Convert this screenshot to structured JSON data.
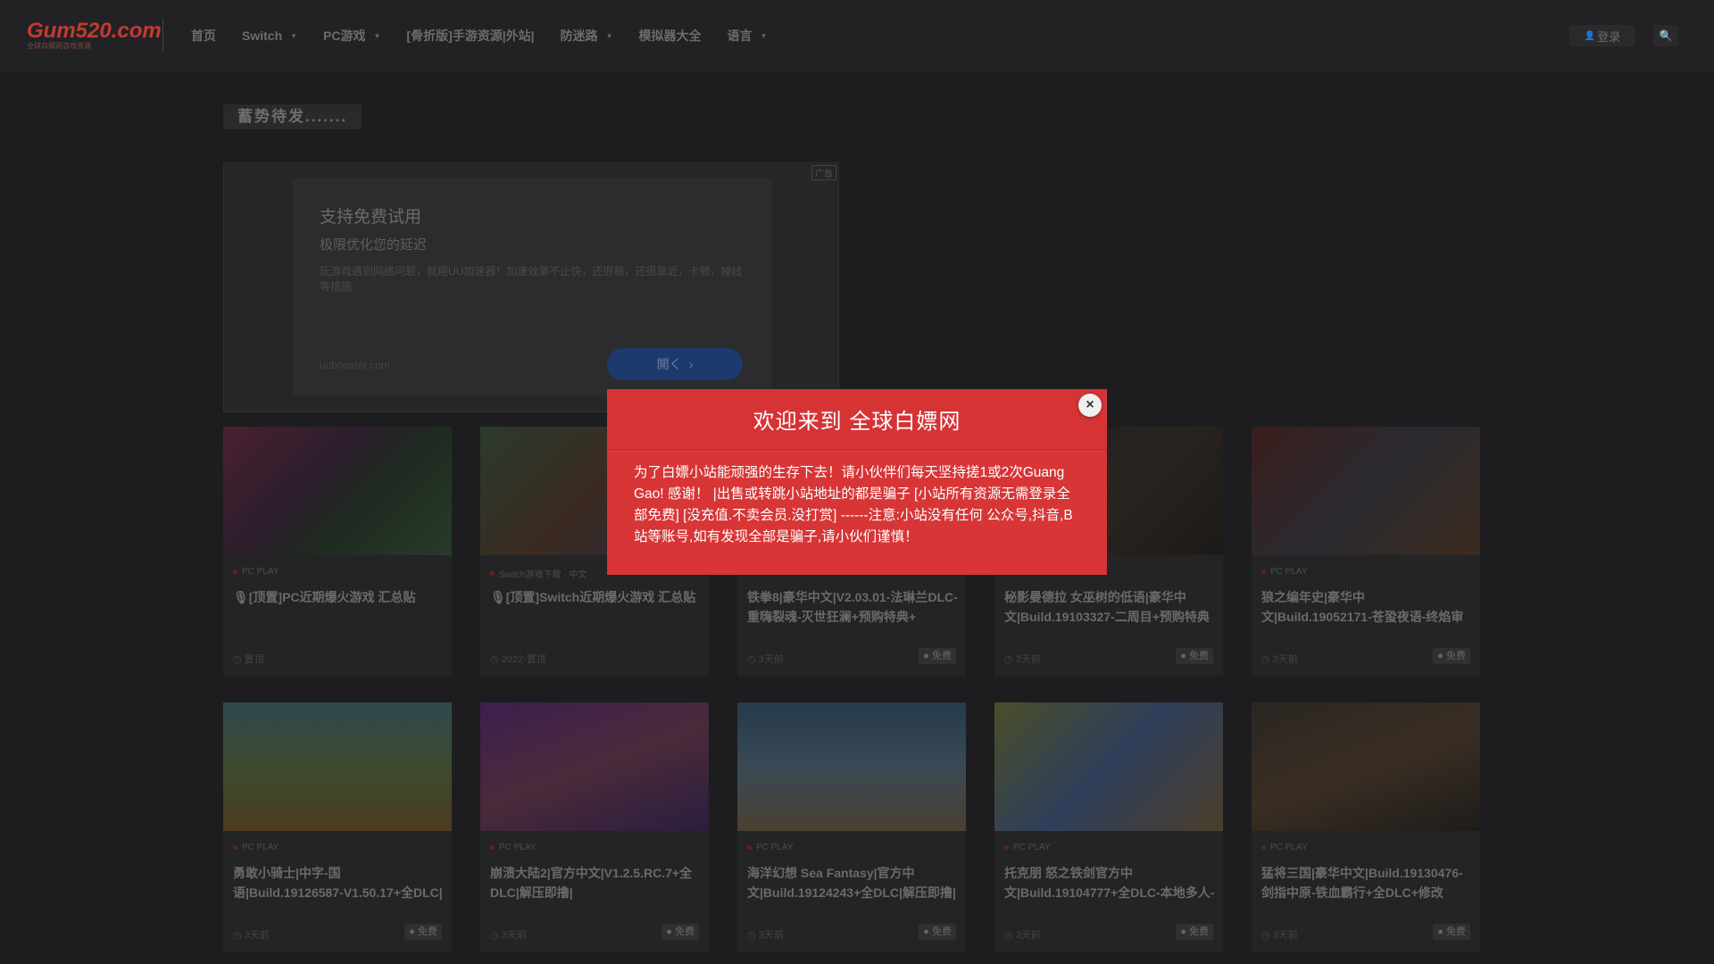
{
  "header": {
    "logo_main": "Gum520.com",
    "logo_sub": "全球白嫖网游戏资源",
    "nav": [
      {
        "label": "首页",
        "dropdown": false
      },
      {
        "label": "Switch",
        "dropdown": true
      },
      {
        "label": "PC游戏",
        "dropdown": true
      },
      {
        "label": "[骨折版]手游资源|外站|",
        "dropdown": false
      },
      {
        "label": "防迷路",
        "dropdown": true
      },
      {
        "label": "模拟器大全",
        "dropdown": false
      },
      {
        "label": "语言",
        "dropdown": true
      }
    ],
    "login_label": "登录",
    "search_icon": "search-icon"
  },
  "section_title": "蓄势待发.......",
  "ad": {
    "tag": "广告",
    "title": "支持免费试用",
    "subtitle": "极限优化您的延迟",
    "description": "玩游戏遇到网络问题，就用UU加速器！加速效果不止快，还很稳，还很靠近，卡顿，掉线等措施",
    "url": "uubooster.com",
    "open_label": "開く"
  },
  "cards_row1": [
    {
      "category": "PC PLAY",
      "title": "🎙[顶置]PC近期爆火游戏 汇总贴",
      "foot": "置顶",
      "free": ""
    },
    {
      "category": "Switch游戏下载 · 中文",
      "title": "🎙[顶置]Switch近期爆火游戏 汇总贴",
      "foot": "2022-置顶",
      "free": ""
    },
    {
      "category": "PC PLAY",
      "title": "铁拳8|豪华中文|V2.03.01-法琳兰DLC-重嗨裂魂-灭世狂澜+预购特典+",
      "foot": "3天前",
      "free": "免费"
    },
    {
      "category": "PC PLAY",
      "title": "秘影曼德拉 女巫树的低语|豪华中文|Build.19103327-二周目+预购特典",
      "foot": "3天前",
      "free": "免费"
    },
    {
      "category": "PC PLAY",
      "title": "狼之编年史|豪华中文|Build.19052171-苍蛩夜语-终焰审判+全DLC|解",
      "foot": "3天前",
      "free": "免费"
    }
  ],
  "cards_row2": [
    {
      "category": "PC PLAY",
      "title": "勇敢小骑士|中字-国语|Build.19126587-V1.50.17+全DLC|解压即撸|",
      "foot": "3天前",
      "free": "免费"
    },
    {
      "category": "PC PLAY",
      "title": "崩溃大陆2|官方中文|V1.2.5.RC.7+全DLC|解压即撸|",
      "foot": "3天前",
      "free": "免费"
    },
    {
      "category": "PC PLAY",
      "title": "海洋幻想 Sea Fantasy|官方中文|Build.19124243+全DLC|解压即撸|",
      "foot": "3天前",
      "free": "免费"
    },
    {
      "category": "PC PLAY",
      "title": "托克朋 怒之铁剑官方中文|Build.19104777+全DLC-本地多人-支持手",
      "foot": "3天前",
      "free": "免费"
    },
    {
      "category": "PC PLAY",
      "title": "猛将三国|豪华中文|Build.19130476-剑指中原-铁血霸行+全DLC+修改",
      "foot": "3天前",
      "free": "免费"
    }
  ],
  "modal": {
    "title": "欢迎来到 全球白嫖网",
    "close_label": "×",
    "body": "为了白嫖小站能顽强的生存下去！请小伙伴们每天坚持搓1或2次Guang Gao! 感谢！ |出售或转跳小站地址的都是骗子 [小站所有资源无需登录全部免费] [没充值.不卖会员.没打赏] ------注意:小站没有任何 公众号,抖音,B站等账号,如有发现全部是骗子,请小伙们谨慎！"
  },
  "colors": {
    "modal_bg": "#d73536",
    "page_bg": "#1d1d1f",
    "accent": "#c23a32"
  }
}
